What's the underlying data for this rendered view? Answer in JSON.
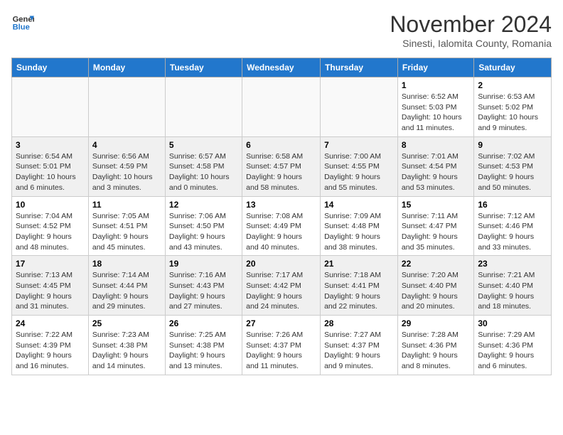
{
  "logo": {
    "line1": "General",
    "line2": "Blue"
  },
  "title": "November 2024",
  "subtitle": "Sinesti, Ialomita County, Romania",
  "days_of_week": [
    "Sunday",
    "Monday",
    "Tuesday",
    "Wednesday",
    "Thursday",
    "Friday",
    "Saturday"
  ],
  "weeks": [
    [
      {
        "day": "",
        "info": ""
      },
      {
        "day": "",
        "info": ""
      },
      {
        "day": "",
        "info": ""
      },
      {
        "day": "",
        "info": ""
      },
      {
        "day": "",
        "info": ""
      },
      {
        "day": "1",
        "info": "Sunrise: 6:52 AM\nSunset: 5:03 PM\nDaylight: 10 hours and 11 minutes."
      },
      {
        "day": "2",
        "info": "Sunrise: 6:53 AM\nSunset: 5:02 PM\nDaylight: 10 hours and 9 minutes."
      }
    ],
    [
      {
        "day": "3",
        "info": "Sunrise: 6:54 AM\nSunset: 5:01 PM\nDaylight: 10 hours and 6 minutes."
      },
      {
        "day": "4",
        "info": "Sunrise: 6:56 AM\nSunset: 4:59 PM\nDaylight: 10 hours and 3 minutes."
      },
      {
        "day": "5",
        "info": "Sunrise: 6:57 AM\nSunset: 4:58 PM\nDaylight: 10 hours and 0 minutes."
      },
      {
        "day": "6",
        "info": "Sunrise: 6:58 AM\nSunset: 4:57 PM\nDaylight: 9 hours and 58 minutes."
      },
      {
        "day": "7",
        "info": "Sunrise: 7:00 AM\nSunset: 4:55 PM\nDaylight: 9 hours and 55 minutes."
      },
      {
        "day": "8",
        "info": "Sunrise: 7:01 AM\nSunset: 4:54 PM\nDaylight: 9 hours and 53 minutes."
      },
      {
        "day": "9",
        "info": "Sunrise: 7:02 AM\nSunset: 4:53 PM\nDaylight: 9 hours and 50 minutes."
      }
    ],
    [
      {
        "day": "10",
        "info": "Sunrise: 7:04 AM\nSunset: 4:52 PM\nDaylight: 9 hours and 48 minutes."
      },
      {
        "day": "11",
        "info": "Sunrise: 7:05 AM\nSunset: 4:51 PM\nDaylight: 9 hours and 45 minutes."
      },
      {
        "day": "12",
        "info": "Sunrise: 7:06 AM\nSunset: 4:50 PM\nDaylight: 9 hours and 43 minutes."
      },
      {
        "day": "13",
        "info": "Sunrise: 7:08 AM\nSunset: 4:49 PM\nDaylight: 9 hours and 40 minutes."
      },
      {
        "day": "14",
        "info": "Sunrise: 7:09 AM\nSunset: 4:48 PM\nDaylight: 9 hours and 38 minutes."
      },
      {
        "day": "15",
        "info": "Sunrise: 7:11 AM\nSunset: 4:47 PM\nDaylight: 9 hours and 35 minutes."
      },
      {
        "day": "16",
        "info": "Sunrise: 7:12 AM\nSunset: 4:46 PM\nDaylight: 9 hours and 33 minutes."
      }
    ],
    [
      {
        "day": "17",
        "info": "Sunrise: 7:13 AM\nSunset: 4:45 PM\nDaylight: 9 hours and 31 minutes."
      },
      {
        "day": "18",
        "info": "Sunrise: 7:14 AM\nSunset: 4:44 PM\nDaylight: 9 hours and 29 minutes."
      },
      {
        "day": "19",
        "info": "Sunrise: 7:16 AM\nSunset: 4:43 PM\nDaylight: 9 hours and 27 minutes."
      },
      {
        "day": "20",
        "info": "Sunrise: 7:17 AM\nSunset: 4:42 PM\nDaylight: 9 hours and 24 minutes."
      },
      {
        "day": "21",
        "info": "Sunrise: 7:18 AM\nSunset: 4:41 PM\nDaylight: 9 hours and 22 minutes."
      },
      {
        "day": "22",
        "info": "Sunrise: 7:20 AM\nSunset: 4:40 PM\nDaylight: 9 hours and 20 minutes."
      },
      {
        "day": "23",
        "info": "Sunrise: 7:21 AM\nSunset: 4:40 PM\nDaylight: 9 hours and 18 minutes."
      }
    ],
    [
      {
        "day": "24",
        "info": "Sunrise: 7:22 AM\nSunset: 4:39 PM\nDaylight: 9 hours and 16 minutes."
      },
      {
        "day": "25",
        "info": "Sunrise: 7:23 AM\nSunset: 4:38 PM\nDaylight: 9 hours and 14 minutes."
      },
      {
        "day": "26",
        "info": "Sunrise: 7:25 AM\nSunset: 4:38 PM\nDaylight: 9 hours and 13 minutes."
      },
      {
        "day": "27",
        "info": "Sunrise: 7:26 AM\nSunset: 4:37 PM\nDaylight: 9 hours and 11 minutes."
      },
      {
        "day": "28",
        "info": "Sunrise: 7:27 AM\nSunset: 4:37 PM\nDaylight: 9 hours and 9 minutes."
      },
      {
        "day": "29",
        "info": "Sunrise: 7:28 AM\nSunset: 4:36 PM\nDaylight: 9 hours and 8 minutes."
      },
      {
        "day": "30",
        "info": "Sunrise: 7:29 AM\nSunset: 4:36 PM\nDaylight: 9 hours and 6 minutes."
      }
    ]
  ]
}
